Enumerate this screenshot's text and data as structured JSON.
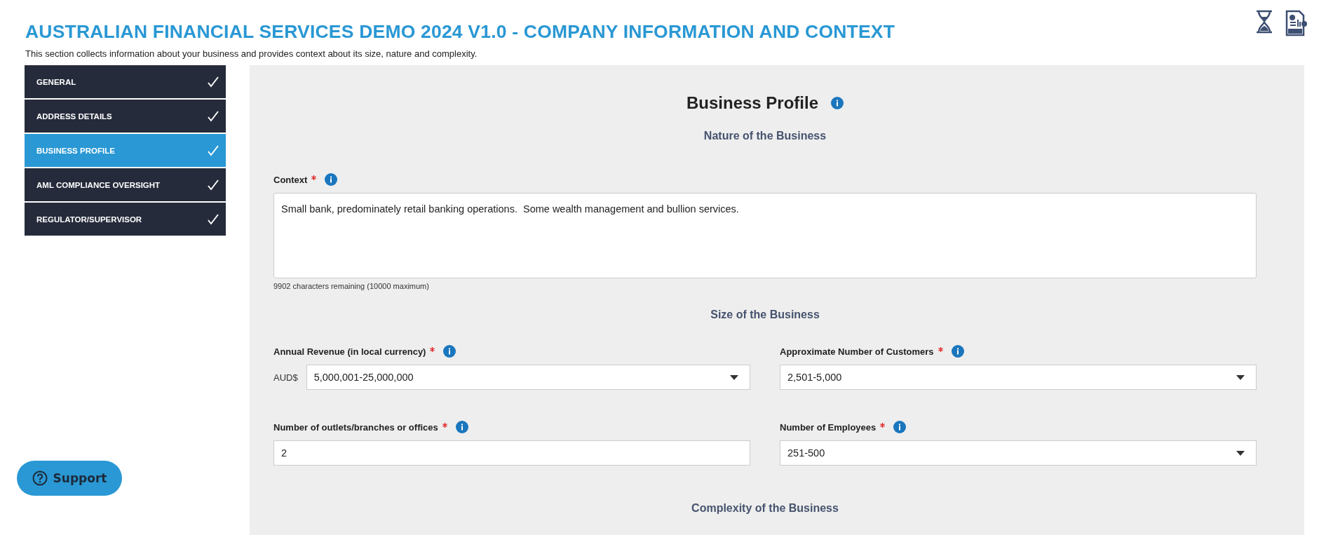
{
  "header": {
    "title": "AUSTRALIAN FINANCIAL SERVICES DEMO 2024 V1.0 - COMPANY INFORMATION AND CONTEXT",
    "subtitle": "This section collects information about your business and provides context about its size, nature and complexity."
  },
  "sidebar": {
    "items": [
      {
        "label": "GENERAL",
        "checked": true,
        "selected": false
      },
      {
        "label": "ADDRESS DETAILS",
        "checked": true,
        "selected": false
      },
      {
        "label": "BUSINESS PROFILE",
        "checked": true,
        "selected": true
      },
      {
        "label": "AML COMPLIANCE OVERSIGHT",
        "checked": true,
        "selected": false
      },
      {
        "label": "REGULATOR/SUPERVISOR",
        "checked": true,
        "selected": false
      }
    ]
  },
  "form": {
    "title": "Business Profile",
    "nature_heading": "Nature of the Business",
    "context": {
      "label": "Context",
      "required": true,
      "value": "Small bank, predominately retail banking operations.  Some wealth management and bullion services.",
      "counter": "9902 characters remaining (10000 maximum)"
    },
    "size_heading": "Size of the Business",
    "fields": [
      {
        "kind": "select",
        "label": "Annual Revenue (in local currency)",
        "required": true,
        "prefix": "AUD$",
        "value": "5,000,001-25,000,000"
      },
      {
        "kind": "select",
        "label": "Approximate Number of Customers",
        "required": true,
        "value": "2,501-5,000"
      },
      {
        "kind": "text",
        "label": "Number of outlets/branches or offices",
        "required": true,
        "value": "2"
      },
      {
        "kind": "select",
        "label": "Number of Employees",
        "required": true,
        "value": "251-500"
      }
    ],
    "complexity_heading": "Complexity of the Business"
  },
  "support_button": {
    "label": "Support"
  }
}
